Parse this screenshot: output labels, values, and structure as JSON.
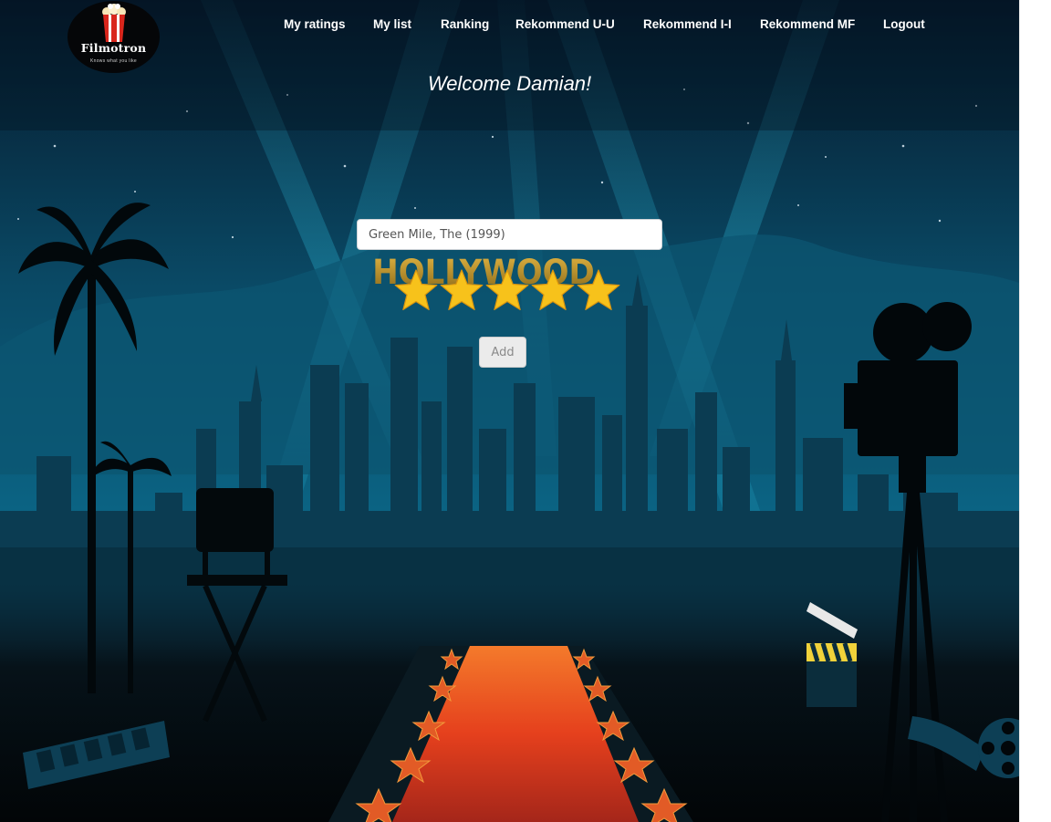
{
  "brand": {
    "name": "Filmotron",
    "tagline": "Knows what you like"
  },
  "nav": {
    "items": [
      {
        "label": "My ratings"
      },
      {
        "label": "My list"
      },
      {
        "label": "Ranking"
      },
      {
        "label": "Rekommend U-U"
      },
      {
        "label": "Rekommend I-I"
      },
      {
        "label": "Rekommend MF"
      },
      {
        "label": "Logout"
      }
    ]
  },
  "welcome": "Welcome Damian!",
  "form": {
    "movie_value": "Green Mile, The (1999)",
    "rating": {
      "value": 5,
      "max": 5
    },
    "add_label": "Add"
  },
  "background": {
    "sign_text": "HOLLYWOOD",
    "colors": {
      "sky_top": "#061b29",
      "sky_mid": "#0b5e7b",
      "skyline": "#0a3346",
      "carpet": "#d9391f",
      "star_fill": "#f7c21b"
    }
  }
}
